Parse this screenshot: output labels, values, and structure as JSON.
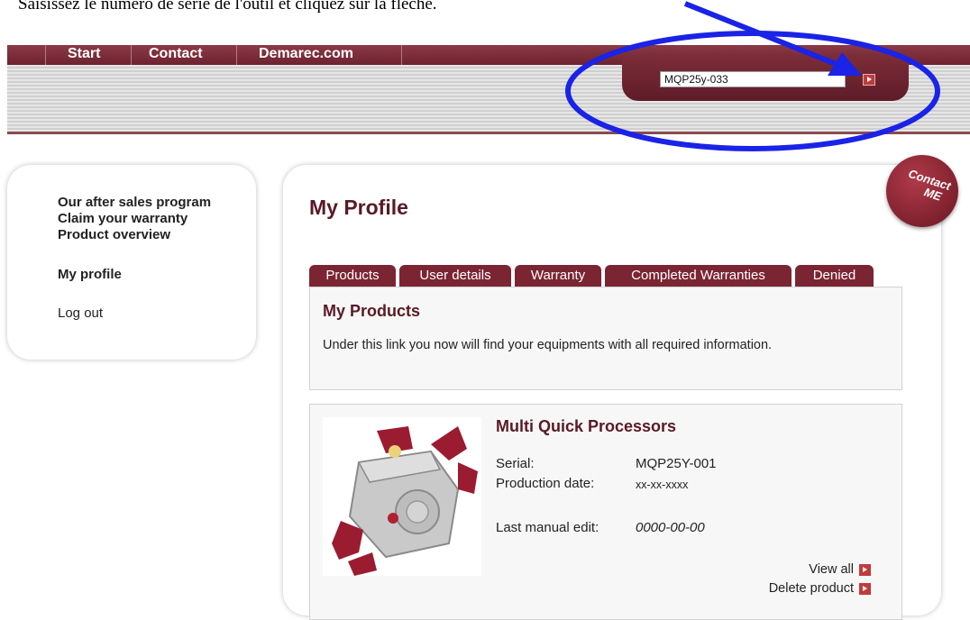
{
  "caption": "Saisissez le numéro de série de l'outil et cliquez sur la flèche.",
  "nav": {
    "items": [
      "Start",
      "Contact",
      "Demarec.com"
    ]
  },
  "search": {
    "value": "MQP25y-033"
  },
  "sidebar": {
    "items": [
      {
        "label": "Our after sales program"
      },
      {
        "label": "Claim your warranty"
      },
      {
        "label": "Product overview"
      },
      {
        "label": "My profile"
      },
      {
        "label": "Log out"
      }
    ]
  },
  "page": {
    "title": "My Profile",
    "contact_badge": [
      "Contact",
      "ME"
    ]
  },
  "tabs": [
    "Products",
    "User details",
    "Warranty",
    "Completed Warranties",
    "Denied"
  ],
  "products_section": {
    "heading": "My Products",
    "description": "Under this link you now will find your equipments with all required information."
  },
  "product": {
    "name": "Multi Quick Processors",
    "serial_label": "Serial:",
    "serial_value": "MQP25Y-001",
    "production_label": "Production date:",
    "production_value": "xx-xx-xxxx",
    "manual_label": "Last manual edit:",
    "manual_value": "0000-00-00",
    "view_all": "View all",
    "delete": "Delete product"
  },
  "colors": {
    "brand": "#7b2533",
    "annotation": "#1a23e6",
    "button_red": "#c23a3a"
  }
}
